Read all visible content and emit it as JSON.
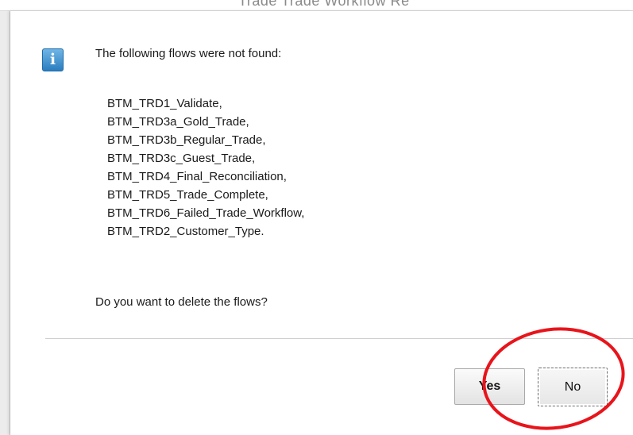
{
  "background": {
    "partial_text": "Trade         Trade Workflow         Re"
  },
  "dialog": {
    "icon": "info-icon",
    "message": "The following flows were not found:",
    "flows": [
      "BTM_TRD1_Validate,",
      "BTM_TRD3a_Gold_Trade,",
      "BTM_TRD3b_Regular_Trade,",
      "BTM_TRD3c_Guest_Trade,",
      "BTM_TRD4_Final_Reconciliation,",
      "BTM_TRD5_Trade_Complete,",
      "BTM_TRD6_Failed_Trade_Workflow,",
      "BTM_TRD2_Customer_Type."
    ],
    "question": "Do you want to delete the flows?",
    "buttons": {
      "yes_label": "Yes",
      "no_label": "No"
    }
  },
  "annotation": {
    "shape": "ellipse",
    "color": "#e8141b"
  },
  "colors": {
    "icon_blue": "#2a7dbf",
    "annotation_red": "#e8141b"
  }
}
